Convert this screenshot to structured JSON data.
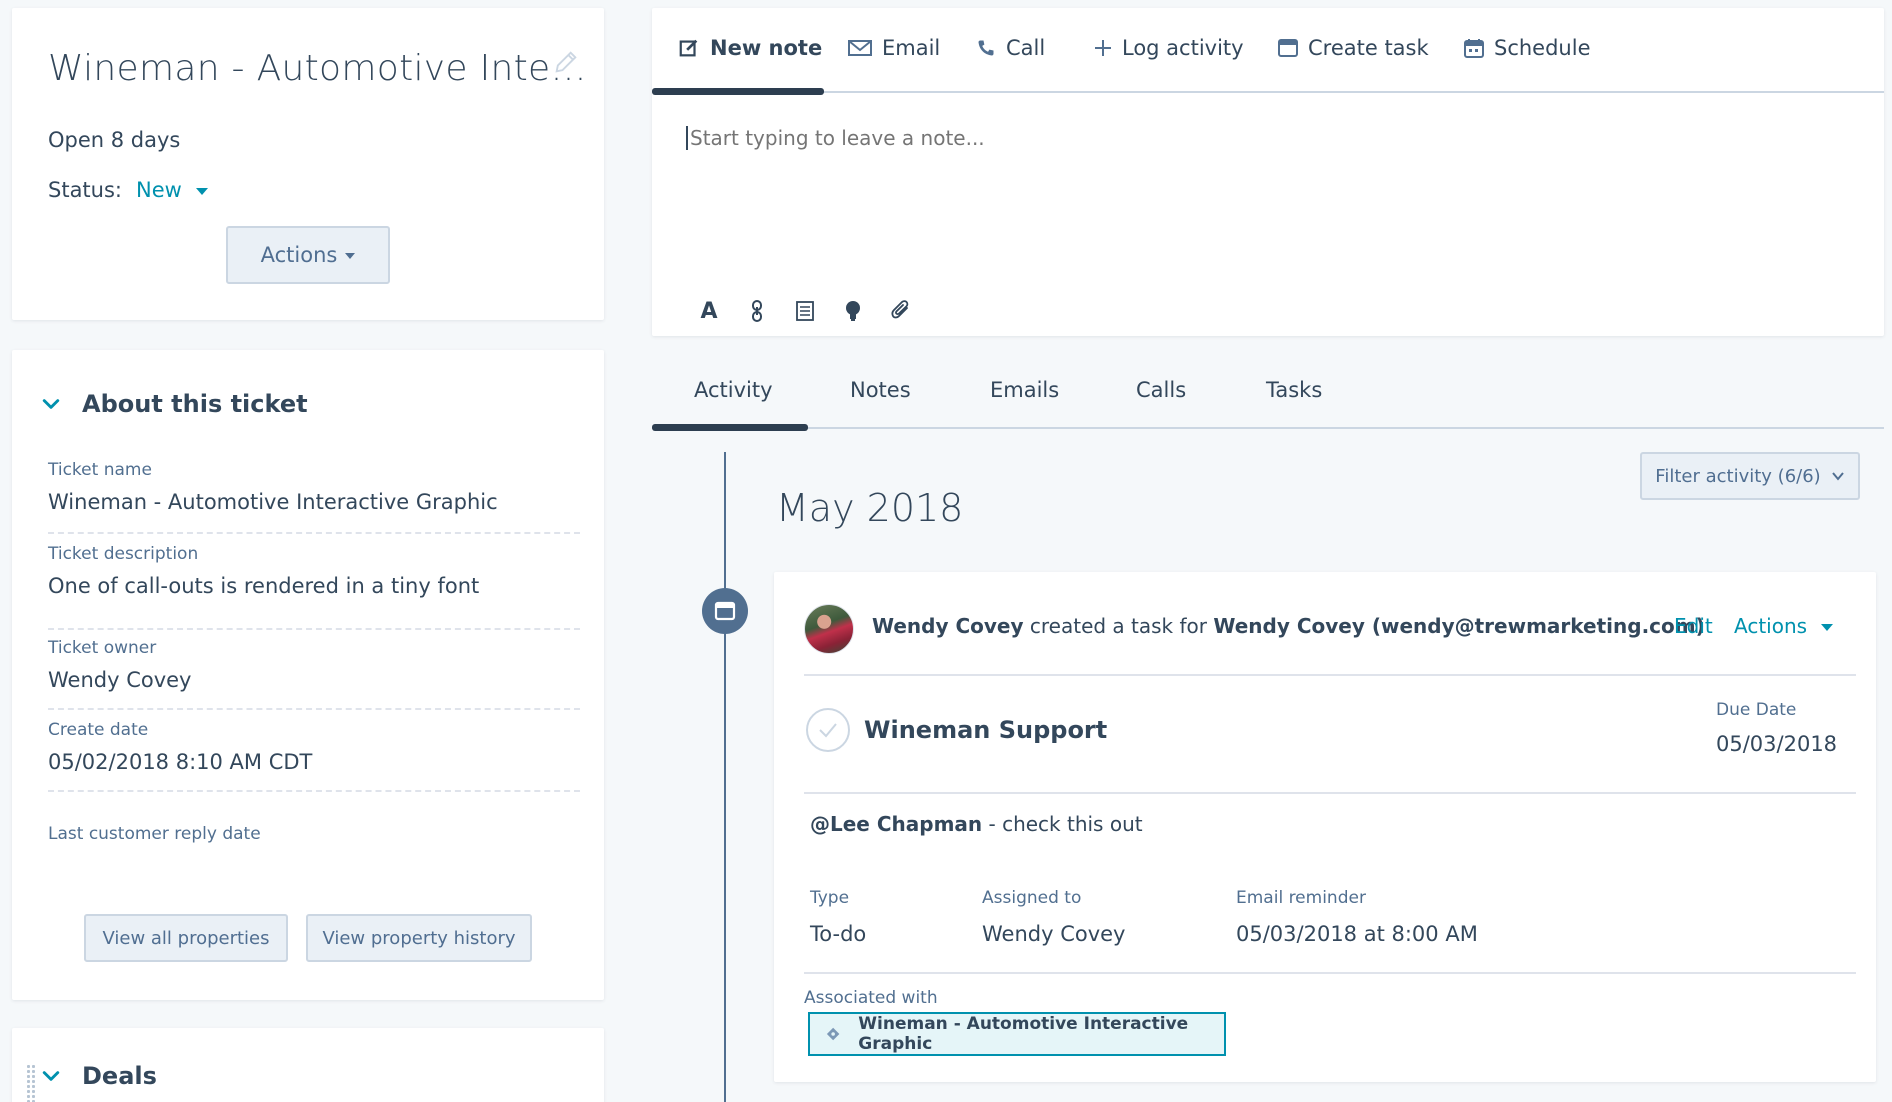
{
  "summary": {
    "title": "Wineman - Automotive Inte…",
    "open_days": "Open 8 days",
    "status_label": "Status:",
    "status_value": "New",
    "actions_label": "Actions"
  },
  "about": {
    "heading": "About this ticket",
    "properties": [
      {
        "label": "Ticket name",
        "value": "Wineman - Automotive Interactive Graphic"
      },
      {
        "label": "Ticket description",
        "value": "One of call-outs is rendered in a tiny font"
      },
      {
        "label": "Ticket owner",
        "value": "Wendy Covey"
      },
      {
        "label": "Create date",
        "value": "05/02/2018 8:10 AM CDT"
      },
      {
        "label": "Last customer reply date",
        "value": ""
      }
    ],
    "view_all_label": "View all properties",
    "view_history_label": "View property history"
  },
  "deals": {
    "heading": "Deals"
  },
  "composer": {
    "tabs": [
      {
        "label": "New note",
        "icon": "edit-icon"
      },
      {
        "label": "Email",
        "icon": "envelope-icon"
      },
      {
        "label": "Call",
        "icon": "phone-icon"
      },
      {
        "label": "Log activity",
        "icon": "plus-icon"
      },
      {
        "label": "Create task",
        "icon": "task-icon"
      },
      {
        "label": "Schedule",
        "icon": "calendar-icon"
      }
    ],
    "placeholder": "Start typing to leave a note...",
    "toolbar": [
      "text-style-icon",
      "link-icon",
      "document-icon",
      "lightbulb-icon",
      "paperclip-icon"
    ]
  },
  "activity_tabs": [
    "Activity",
    "Notes",
    "Emails",
    "Calls",
    "Tasks"
  ],
  "timeline": {
    "month": "May 2018",
    "filter_label": "Filter activity (6/6)"
  },
  "task": {
    "author": "Wendy Covey",
    "verb": "created a task for",
    "target": "Wendy Covey (wendy@trewmarketing.com)",
    "edit_label": "Edit",
    "actions_label": "Actions",
    "title": "Wineman Support",
    "due_label": "Due Date",
    "due_value": "05/03/2018",
    "mention": "@Lee Chapman",
    "body_rest": " - check this out",
    "type_label": "Type",
    "type_value": "To-do",
    "assigned_label": "Assigned to",
    "assigned_value": "Wendy Covey",
    "reminder_label": "Email reminder",
    "reminder_value": "05/03/2018 at 8:00 AM",
    "assoc_label": "Associated with",
    "assoc_value": "Wineman - Automotive Interactive Graphic"
  },
  "colors": {
    "accent": "#0091ae",
    "text": "#33475b",
    "muted": "#516f90",
    "background": "#f5f8fa"
  }
}
